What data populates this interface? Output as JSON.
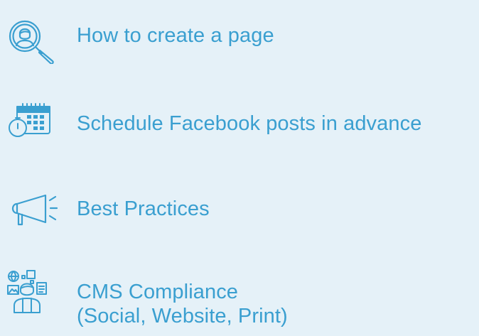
{
  "colors": {
    "background": "#e5f1f8",
    "accent": "#3a9fd0"
  },
  "links": [
    {
      "icon": "search-user-icon",
      "label": "How to create a page"
    },
    {
      "icon": "calendar-clock-icon",
      "label": "Schedule Facebook posts in advance"
    },
    {
      "icon": "megaphone-icon",
      "label": "Best Practices"
    },
    {
      "icon": "content-management-icon",
      "label_lines": [
        "CMS Compliance",
        "(Social, Website, Print)"
      ]
    }
  ]
}
